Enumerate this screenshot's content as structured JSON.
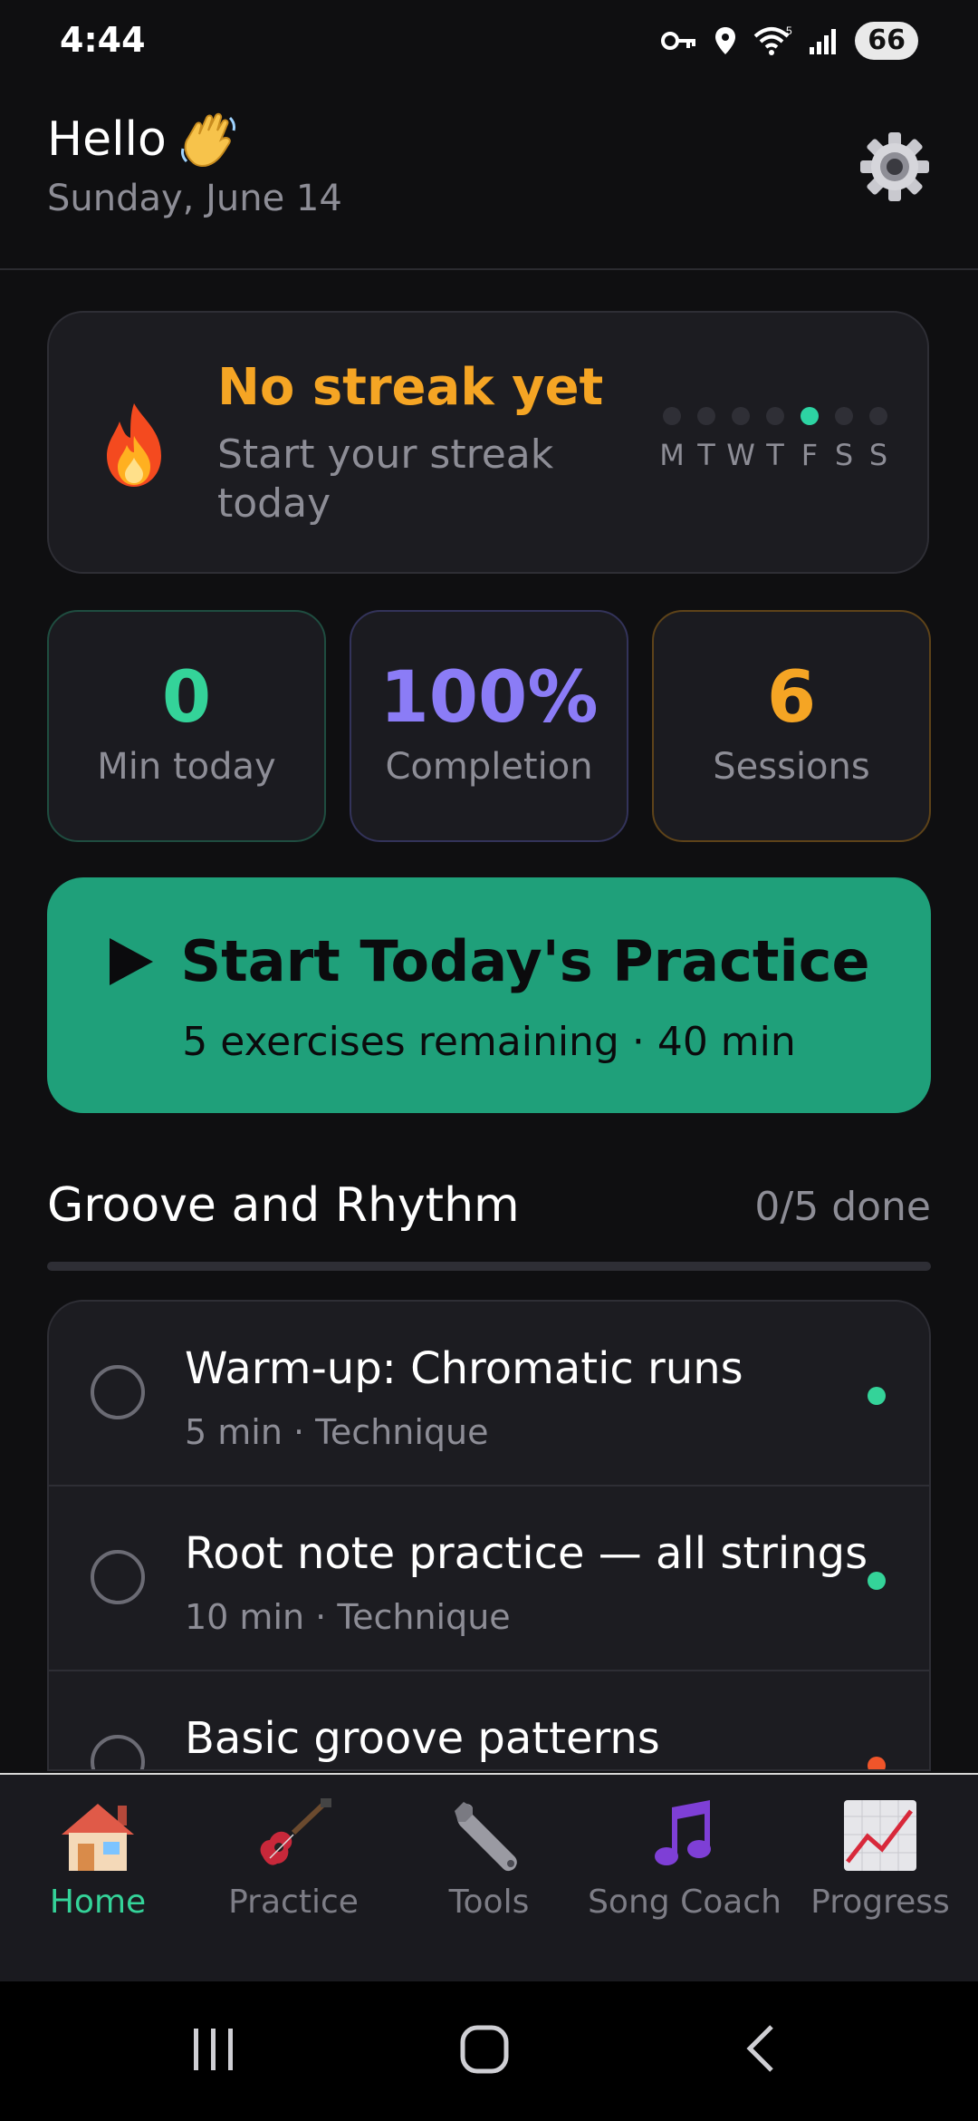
{
  "status_bar": {
    "time": "4:44",
    "battery": "66"
  },
  "header": {
    "greeting": "Hello",
    "date": "Sunday, June 14"
  },
  "streak": {
    "title": "No streak yet",
    "subtitle": "Start your streak today",
    "days": [
      {
        "label": "M",
        "active": false
      },
      {
        "label": "T",
        "active": false
      },
      {
        "label": "W",
        "active": false
      },
      {
        "label": "T",
        "active": false
      },
      {
        "label": "F",
        "active": true
      },
      {
        "label": "S",
        "active": false
      },
      {
        "label": "S",
        "active": false
      }
    ]
  },
  "stats": {
    "minutes": {
      "value": "0",
      "label": "Min today"
    },
    "completion": {
      "value": "100%",
      "label": "Completion"
    },
    "sessions": {
      "value": "6",
      "label": "Sessions"
    }
  },
  "start": {
    "title": "Start Today's Practice",
    "subtitle": "5 exercises remaining · 40 min"
  },
  "section": {
    "title": "Groove and Rhythm",
    "count": "0/5 done",
    "progress_fraction": 0
  },
  "exercises": [
    {
      "name": "Warm-up: Chromatic runs",
      "meta": "5 min · Technique",
      "dot_color": "#34d399"
    },
    {
      "name": "Root note practice — all strings",
      "meta": "10 min · Technique",
      "dot_color": "#34d399"
    },
    {
      "name": "Basic groove patterns",
      "meta": "",
      "dot_color": "#f0552a"
    }
  ],
  "nav": [
    {
      "label": "Home",
      "icon": "house-icon",
      "active": true
    },
    {
      "label": "Practice",
      "icon": "guitar-icon",
      "active": false
    },
    {
      "label": "Tools",
      "icon": "wrench-icon",
      "active": false
    },
    {
      "label": "Song Coach",
      "icon": "music-note-icon",
      "active": false
    },
    {
      "label": "Progress",
      "icon": "chart-icon",
      "active": false
    }
  ],
  "colors": {
    "accent": "#34d399",
    "streak": "#f5a524",
    "completion": "#8b7cf6",
    "button": "#1fa07a"
  }
}
